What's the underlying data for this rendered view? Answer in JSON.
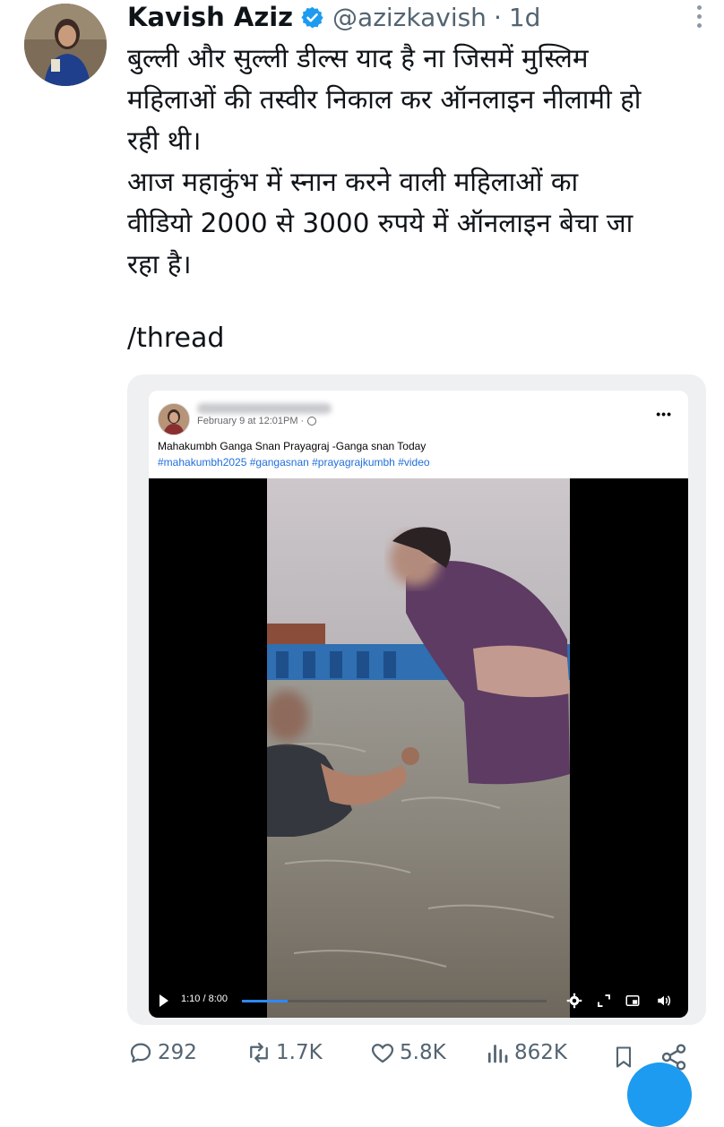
{
  "tweet": {
    "author_name": "Kavish Aziz",
    "handle": "@azizkavish",
    "separator": "·",
    "time": "1d",
    "text": "बुल्ली और सुल्ली डील्स याद है ना जिसमें मुस्लिम\nमहिलाओं की तस्वीर निकाल कर ऑनलाइन नीलामी हो\nरही थी।\nआज महाकुंभ में स्नान करने वाली महिलाओं का\nवीडियो 2000 से 3000 रुपये में ऑनलाइन बेचा जा\nरहा है।",
    "thread_label": "/thread"
  },
  "embedded_post": {
    "timestamp": "February 9 at 12:01PM ·",
    "more_label": "•••",
    "caption": "Mahakumbh Ganga Snan Prayagraj -Ganga snan Today",
    "hashtags": "#mahakumbh2025 #gangasnan #prayagrajkumbh #video"
  },
  "video": {
    "time_display": "1:10 / 8:00",
    "progress_fraction": 0.15
  },
  "actions": {
    "replies": "292",
    "reposts": "1.7K",
    "likes": "5.8K",
    "views": "862K"
  },
  "colors": {
    "verified": "#1d9bf0",
    "muted": "#536471",
    "hashtag": "#216fdb",
    "video_progress": "#2d88ff"
  },
  "icons": [
    "verified-badge-icon",
    "more-icon",
    "globe-icon",
    "play-icon",
    "settings-icon",
    "fullscreen-icon",
    "pip-icon",
    "volume-icon",
    "reply-icon",
    "repost-icon",
    "like-icon",
    "views-icon",
    "bookmark-icon",
    "share-icon"
  ]
}
